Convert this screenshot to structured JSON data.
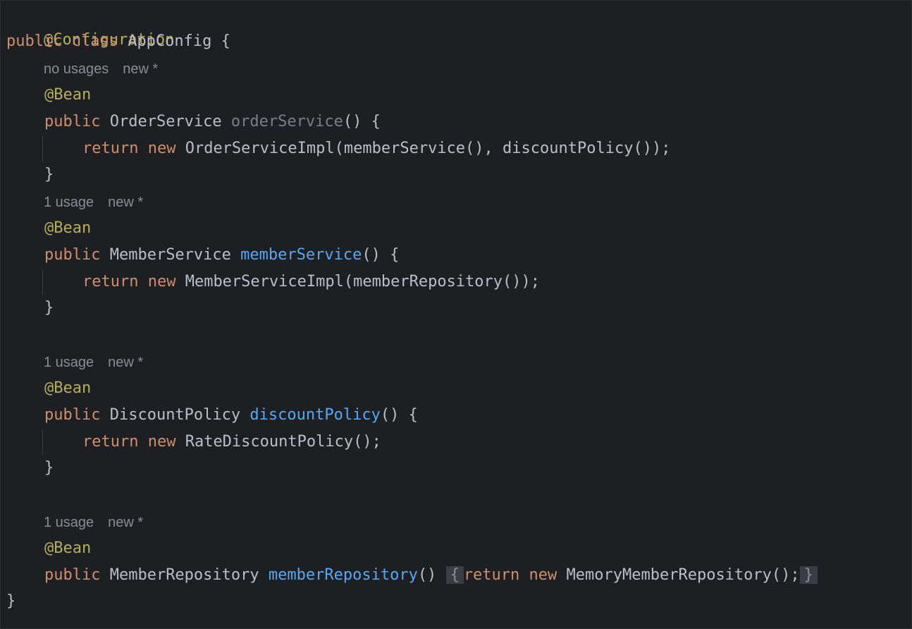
{
  "code": {
    "line1": {
      "annotation": "@Configuration"
    },
    "line2": {
      "kw": "public class ",
      "rest": "AppConfig {"
    },
    "block1": {
      "hint_usages": "no usages",
      "hint_new": "new *",
      "annotation": "@Bean",
      "sig_kw": "public ",
      "sig_type": "OrderService ",
      "sig_name": "orderService",
      "sig_rest": "() {",
      "ret_kw": "return new ",
      "ret_rest": "OrderServiceImpl(memberService(), discountPolicy());",
      "close": "}"
    },
    "block2": {
      "hint_usages": "1 usage",
      "hint_new": "new *",
      "annotation": "@Bean",
      "sig_kw": "public ",
      "sig_type": "MemberService ",
      "sig_name": "memberService",
      "sig_rest": "() {",
      "ret_kw": "return new ",
      "ret_rest": "MemberServiceImpl(memberRepository());",
      "close": "}"
    },
    "block3": {
      "hint_usages": "1 usage",
      "hint_new": "new *",
      "annotation": "@Bean",
      "sig_kw": "public ",
      "sig_type": "DiscountPolicy ",
      "sig_name": "discountPolicy",
      "sig_rest": "() {",
      "ret_kw": "return new ",
      "ret_rest": "RateDiscountPolicy();",
      "close": "}"
    },
    "block4": {
      "hint_usages": "1 usage",
      "hint_new": "new *",
      "annotation": "@Bean",
      "sig_kw": "public ",
      "sig_type": "MemberRepository ",
      "sig_name": "memberRepository",
      "sig_rest": "()",
      "fold_open": "{",
      "ret_kw": "return new ",
      "ret_rest": "MemoryMemberRepository();",
      "fold_close": "}"
    },
    "class_close": "}"
  },
  "colors": {
    "background": "#1e1f22",
    "keyword": "#cf8e6d",
    "annotation": "#b3ae60",
    "method": "#56a8f5",
    "unused_method": "#7a7e85",
    "text": "#bcbec4",
    "hint": "#8a8c91"
  }
}
